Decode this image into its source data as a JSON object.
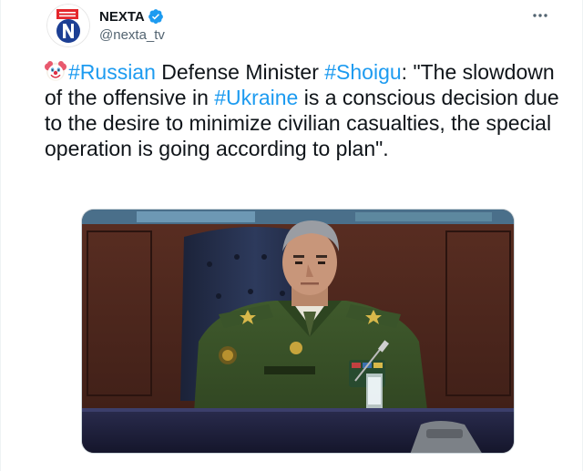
{
  "author": {
    "name": "NEXTA",
    "handle": "@nexta_tv",
    "verified": true,
    "avatar_icon": "nexta-logo"
  },
  "menu": {
    "icon": "more-horizontal-icon"
  },
  "tweet": {
    "emoji": "🤡",
    "segments": [
      {
        "text": "#Russian",
        "type": "hashtag"
      },
      {
        "text": " Defense Minister ",
        "type": "text"
      },
      {
        "text": "#Shoigu",
        "type": "hashtag"
      },
      {
        "text": ": \"The slowdown of the offensive in ",
        "type": "text"
      },
      {
        "text": "#Ukraine",
        "type": "hashtag"
      },
      {
        "text": " is a conscious decision due to the desire to minimize civilian casualties, the special operation is going according to plan\".",
        "type": "text"
      }
    ]
  },
  "media": {
    "type": "photo",
    "subject": "man-in-military-uniform-at-desk"
  },
  "colors": {
    "hashtag": "#1d9bf0",
    "verified": "#1d9bf0",
    "text": "#0f1419",
    "secondary": "#536471",
    "nexta_red": "#e4262c",
    "nexta_blue": "#1c3f94"
  }
}
